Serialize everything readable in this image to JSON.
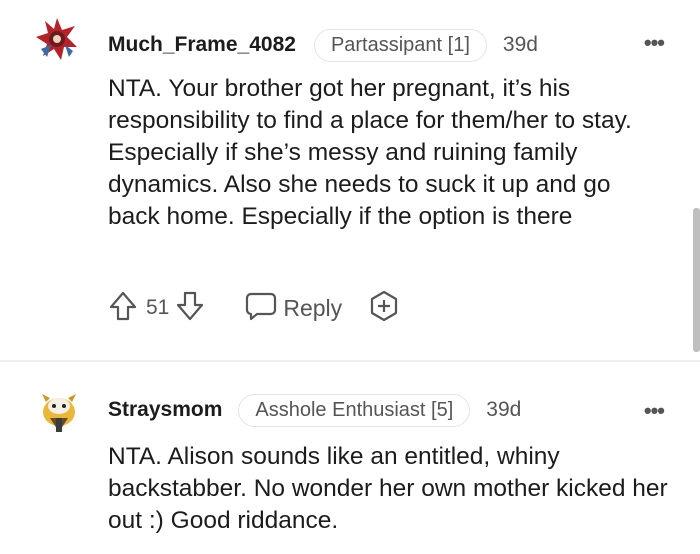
{
  "comments": [
    {
      "username": "Much_Frame_4082",
      "flair": "Partassipant [1]",
      "age": "39d",
      "more_label": "•••",
      "body": "NTA. Your brother got her pregnant, it’s his responsibility to find a place for them/her to stay. Especially if she’s messy and ruining family dynamics. Also she needs to suck it up and go back home. Especially if the option is there",
      "votes": "51",
      "reply_label": "Reply"
    },
    {
      "username": "Straysmom",
      "flair": "Asshole Enthusiast [5]",
      "age": "39d",
      "more_label": "•••",
      "body": "NTA. Alison sounds like an entitled, whiny backstabber. No wonder her own mother kicked her out :) Good riddance."
    }
  ],
  "icons": {
    "upvote": "arrow-up-icon",
    "downvote": "arrow-down-icon",
    "reply": "speech-bubble-icon",
    "award": "award-plus-icon",
    "more": "more-dots-icon"
  },
  "colors": {
    "text": "#1c1c1c",
    "meta": "#555555",
    "divider": "#eeeeee"
  }
}
